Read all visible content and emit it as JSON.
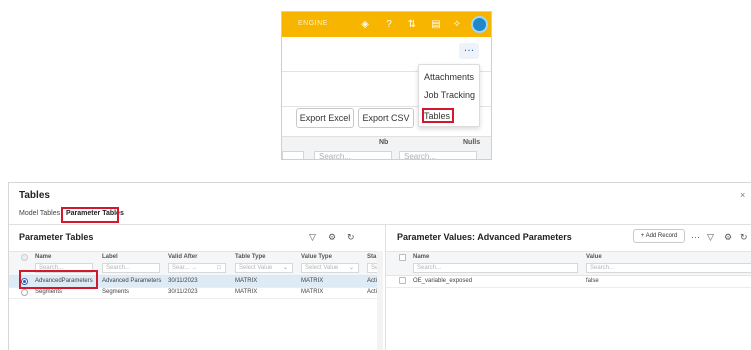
{
  "top_crop": {
    "brand": "ENGINE",
    "more_icon": "ellipsis-icon",
    "menu": [
      "Attachments",
      "Job Tracking",
      "Tables"
    ],
    "export_excel": "Export Excel",
    "export_csv": "Export CSV",
    "columns": [
      "Nb",
      "Nulls"
    ],
    "search_placeholder": "Search..."
  },
  "dialog": {
    "title": "Tables",
    "close": "×",
    "tabs": [
      "Model Tables",
      "Parameter Tables"
    ],
    "left_panel": {
      "title": "Parameter Tables",
      "columns": [
        "Name",
        "Label",
        "Valid After",
        "Table Type",
        "Value Type",
        "Sta"
      ],
      "placeholders": [
        "Search...",
        "Search...",
        "Sear... →",
        "Select Value",
        "Select Value",
        "Se"
      ],
      "rows": [
        [
          "AdvancedParameters",
          "Advanced Parameters",
          "30/11/2023",
          "MATRIX",
          "MATRIX",
          "Acti"
        ],
        [
          "Segments",
          "Segments",
          "30/11/2023",
          "MATRIX",
          "MATRIX",
          "Acti"
        ]
      ],
      "selected_row": 0
    },
    "right_panel": {
      "title": "Parameter Values: Advanced Parameters",
      "add_record": "+ Add Record",
      "more": "···",
      "columns": [
        "Name",
        "Value"
      ],
      "placeholders": [
        "Search...",
        "Search..."
      ],
      "rows": [
        [
          "OE_variable_exposed",
          "false"
        ]
      ]
    }
  },
  "colors": {
    "topbar": "#f7b500",
    "highlight": "#d0192c",
    "accent": "#2a62b8",
    "selected_row": "#dcebf5"
  }
}
